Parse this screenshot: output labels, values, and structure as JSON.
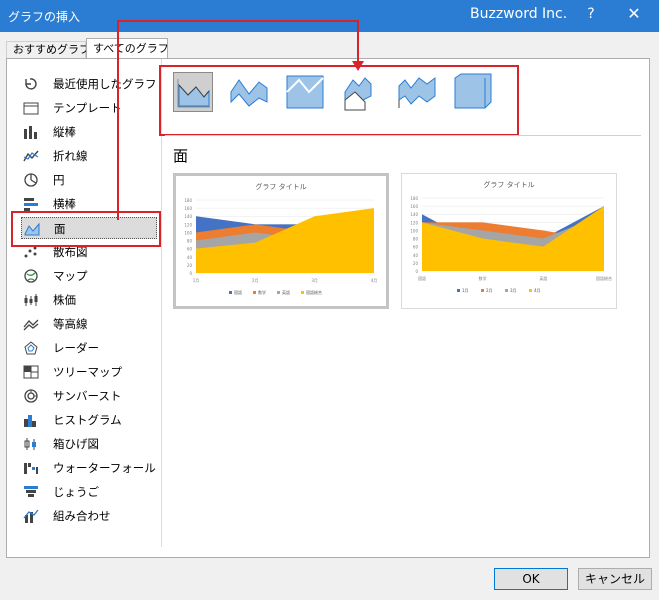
{
  "window": {
    "title": "グラフの挿入",
    "brand": "Buzzword Inc.",
    "help": "?",
    "close": "✕"
  },
  "tabs": [
    {
      "label": "おすすめグラフ"
    },
    {
      "label": "すべてのグラフ"
    }
  ],
  "sidebar": {
    "items": [
      {
        "label": "最近使用したグラフ",
        "icon": "recent-icon"
      },
      {
        "label": "テンプレート",
        "icon": "folder-icon"
      },
      {
        "label": "縦棒",
        "icon": "column-chart-icon"
      },
      {
        "label": "折れ線",
        "icon": "line-chart-icon"
      },
      {
        "label": "円",
        "icon": "pie-chart-icon"
      },
      {
        "label": "横棒",
        "icon": "bar-chart-icon"
      },
      {
        "label": "面",
        "icon": "area-chart-icon"
      },
      {
        "label": "散布図",
        "icon": "scatter-chart-icon"
      },
      {
        "label": "マップ",
        "icon": "map-chart-icon"
      },
      {
        "label": "株価",
        "icon": "stock-chart-icon"
      },
      {
        "label": "等高線",
        "icon": "surface-chart-icon"
      },
      {
        "label": "レーダー",
        "icon": "radar-chart-icon"
      },
      {
        "label": "ツリーマップ",
        "icon": "treemap-chart-icon"
      },
      {
        "label": "サンバースト",
        "icon": "sunburst-chart-icon"
      },
      {
        "label": "ヒストグラム",
        "icon": "histogram-chart-icon"
      },
      {
        "label": "箱ひげ図",
        "icon": "box-whisker-chart-icon"
      },
      {
        "label": "ウォーターフォール",
        "icon": "waterfall-chart-icon"
      },
      {
        "label": "じょうご",
        "icon": "funnel-chart-icon"
      },
      {
        "label": "組み合わせ",
        "icon": "combo-chart-icon"
      }
    ],
    "selected_index": 6
  },
  "section": {
    "heading": "面"
  },
  "colors": {
    "accent": "#2b7cd3",
    "red": "#d8232a",
    "blue": "#4472c4",
    "orange": "#ed7d31",
    "gray": "#a5a5a5",
    "yellow": "#ffc000",
    "area_icon": "#9dc3e6"
  },
  "chart_data": [
    {
      "type": "area",
      "title": "グラフ タイトル",
      "categories": [
        "1月",
        "2月",
        "3月",
        "4月"
      ],
      "ylim": [
        0,
        180
      ],
      "yticks": [
        "0",
        "20",
        "40",
        "60",
        "80",
        "100",
        "120",
        "140",
        "160",
        "180"
      ],
      "series": [
        {
          "name": "国語",
          "values": [
            140,
            120,
            120,
            120
          ]
        },
        {
          "name": "数学",
          "values": [
            100,
            120,
            100,
            80
          ]
        },
        {
          "name": "英語",
          "values": [
            80,
            100,
            80,
            60
          ]
        },
        {
          "name": "国語総合",
          "values": [
            60,
            75,
            140,
            160
          ]
        }
      ]
    },
    {
      "type": "area",
      "title": "グラフ タイトル",
      "categories": [
        "国語",
        "数学",
        "英語",
        "国語総合"
      ],
      "ylim": [
        0,
        180
      ],
      "yticks": [
        "0",
        "20",
        "40",
        "60",
        "80",
        "100",
        "120",
        "140",
        "160",
        "180"
      ],
      "series": [
        {
          "name": "1月",
          "values": [
            140,
            60,
            80,
            160
          ]
        },
        {
          "name": "2月",
          "values": [
            120,
            120,
            100,
            75
          ]
        },
        {
          "name": "3月",
          "values": [
            120,
            100,
            80,
            140
          ]
        },
        {
          "name": "4月",
          "values": [
            120,
            80,
            60,
            160
          ]
        }
      ]
    }
  ]
}
